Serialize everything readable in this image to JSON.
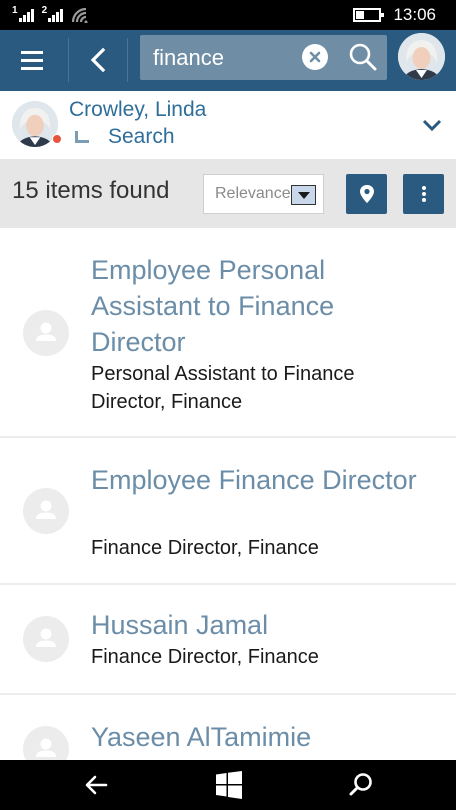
{
  "status_bar": {
    "sim1": "1",
    "sim2": "2",
    "time": "13:06",
    "icons": [
      "signal-sim1-icon",
      "signal-sim2-icon",
      "wifi-icon",
      "battery-icon"
    ]
  },
  "app_bar": {
    "menu_icon": "hamburger-icon",
    "back_icon": "chevron-left-icon",
    "search": {
      "value": "finance",
      "placeholder": ""
    },
    "clear_icon": "clear-circle-x-icon",
    "search_icon": "magnifier-icon",
    "profile_icon": "avatar-photo",
    "colors": {
      "bar": "#2b5a80",
      "search_field": "#6f8ea6"
    }
  },
  "context": {
    "user_name": "Crowley, Linda",
    "location_label": "Search",
    "presence_color": "#e8543b",
    "expand_icon": "chevron-down-icon"
  },
  "toolbar": {
    "result_count": "15 items found",
    "sort": {
      "selected": "Relevance"
    },
    "map_icon": "location-pin-icon",
    "more_icon": "vertical-ellipsis-icon"
  },
  "results": [
    {
      "title": "Employee Personal Assistant to Finance Director",
      "subtitle": "Personal Assistant to Finance Director, Finance"
    },
    {
      "title": "Employee Finance Director",
      "subtitle": "Finance Director, Finance"
    },
    {
      "title": "Hussain Jamal",
      "subtitle": "Finance Director, Finance"
    },
    {
      "title": "Yaseen AlTamimie",
      "subtitle": ""
    }
  ],
  "nav_bar": {
    "back_icon": "arrow-left-icon",
    "start_icon": "windows-logo-icon",
    "search_icon": "search-icon"
  }
}
